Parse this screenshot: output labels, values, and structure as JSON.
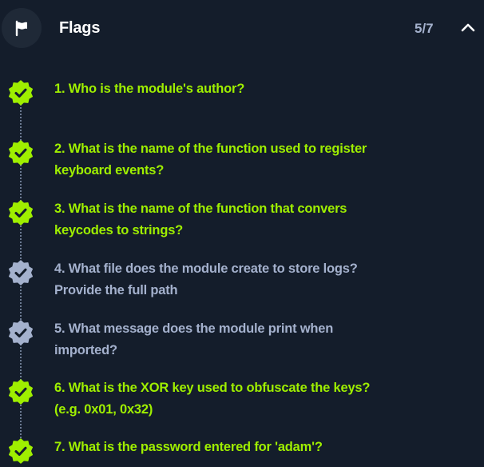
{
  "header": {
    "title": "Flags",
    "count": "5/7",
    "icon": "flag-icon",
    "toggle_icon": "chevron-up-icon"
  },
  "colors": {
    "background": "#141d2b",
    "solved": "#9fef00",
    "unsolved": "#a4b1cd"
  },
  "flags": [
    {
      "text": "1. Who is the module's author?",
      "solved": true
    },
    {
      "text": "2. What is the name of the function used to register keyboard events?",
      "solved": true
    },
    {
      "text": "3. What is the name of the function that convers keycodes to strings?",
      "solved": true
    },
    {
      "text": "4. What file does the module create to store logs? Provide the full path",
      "solved": false
    },
    {
      "text": "5. What message does the module print when imported?",
      "solved": false
    },
    {
      "text": "6. What is the XOR key used to obfuscate the keys? (e.g. 0x01, 0x32)",
      "solved": true
    },
    {
      "text": "7. What is the password entered for 'adam'?",
      "solved": true
    }
  ]
}
